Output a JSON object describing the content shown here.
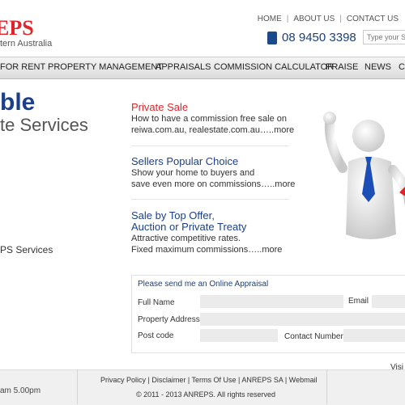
{
  "header": {
    "logo_text": "EPS",
    "logo_sub": "tern Australia",
    "top_links": [
      "HOME",
      "ABOUT US",
      "CONTACT US"
    ],
    "phone": "08 9450 3398",
    "search_placeholder": "Type your Se"
  },
  "nav": {
    "items": [
      "FOR RENT",
      "PROPERTY MANAGEMENT",
      "APPRAISALS",
      "COMMISSION CALCULATOR",
      "PRAISE",
      "NEWS",
      "C"
    ]
  },
  "hero": {
    "big": "ble",
    "sub": "te Services",
    "left_services": "PS Services"
  },
  "blocks": [
    {
      "title": "Private Sale",
      "line1": "How to have a commission free sale on",
      "line2": "reiwa.com.au, realestate.com.au…..more"
    },
    {
      "title": "Sellers Popular Choice",
      "line1": "Show your home to buyers and",
      "line2": "save even more on commissions…..more"
    },
    {
      "title": "Sale by Top Offer,",
      "title2": "Auction or Private Treaty",
      "line1": "Attractive competitive rates.",
      "line2": "Fixed maximum commissions…..more"
    }
  ],
  "form": {
    "title": "Please send me an Online Appraisal",
    "full_name": "Full Name",
    "email": "Email",
    "property_address": "Property Address",
    "post_code": "Post code",
    "contact_number": "Contact Number"
  },
  "footer": {
    "left": "am 5.00pm",
    "links": "Privacy Policy | Disclaimer | Terms Of Use | ANREPS SA | Webmail",
    "copyright": "© 2011 - 2013 ANREPS.  All rights reserved",
    "right": "Visi"
  },
  "colors": {
    "brand_red": "#e0252a",
    "brand_blue": "#1b3f8a"
  }
}
